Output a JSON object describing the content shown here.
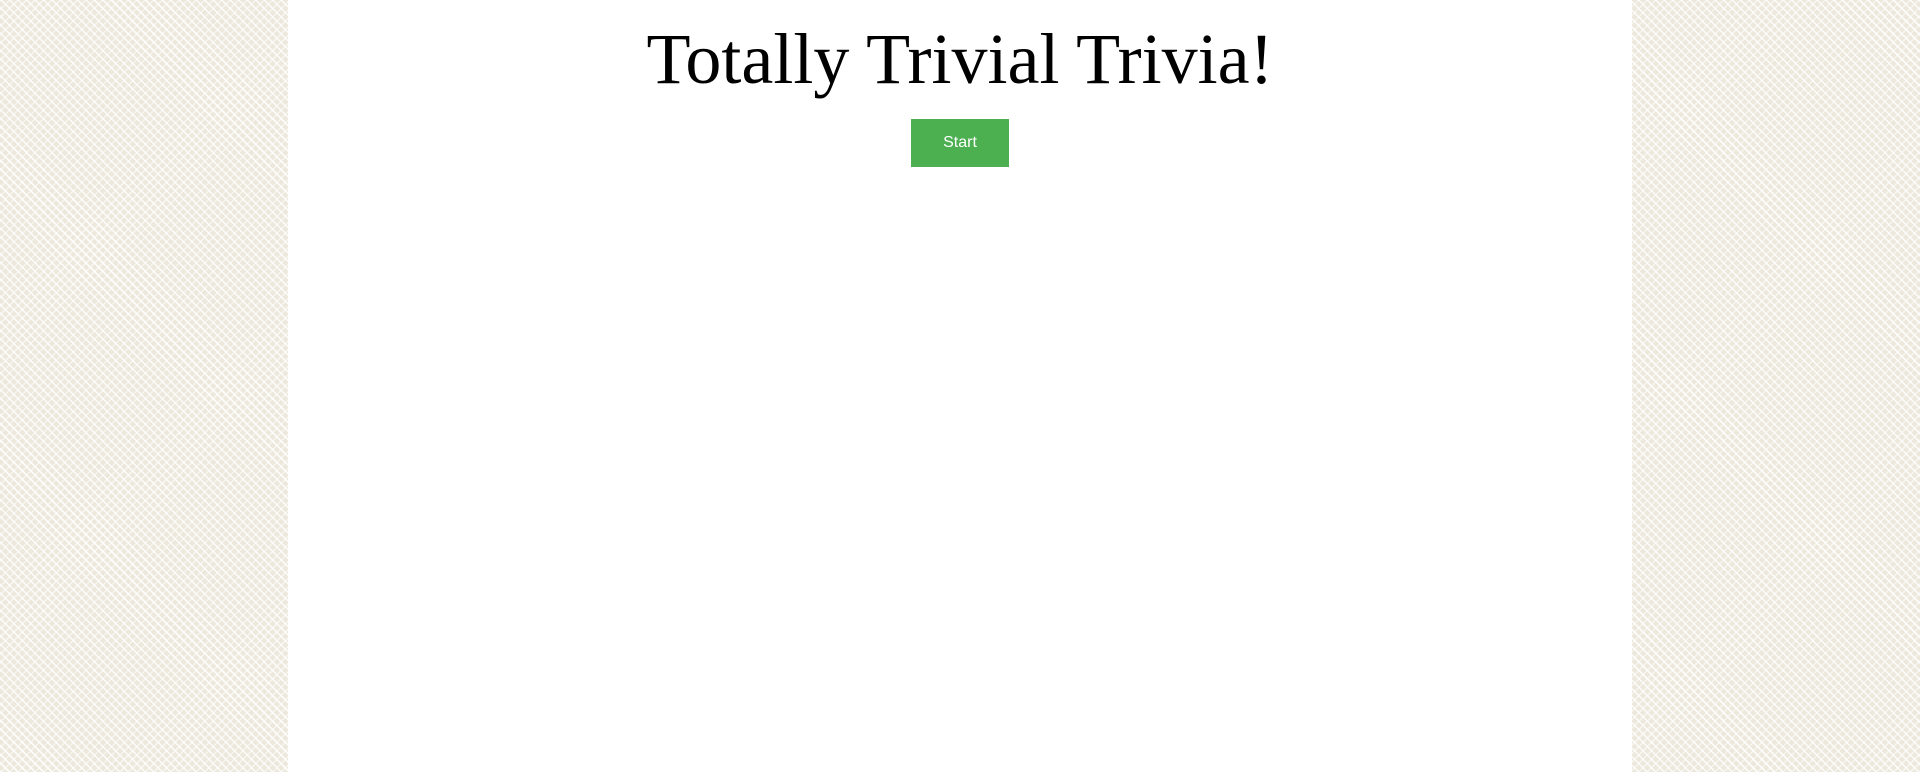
{
  "page": {
    "title": "Totally Trivial Trivia!",
    "start_label": "Start"
  },
  "colors": {
    "background": "#ede8dc",
    "panel": "#ffffff",
    "start_button": "#4caf50",
    "start_button_text": "#ffffff",
    "title_text": "#000000"
  }
}
